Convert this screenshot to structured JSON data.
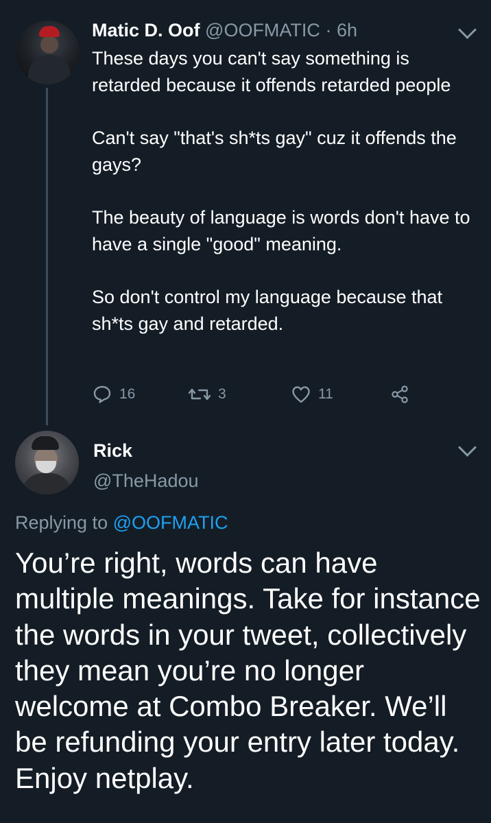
{
  "parent_tweet": {
    "author_name": "Matic D. Oof",
    "handle": "@OOFMATIC",
    "separator": "·",
    "time": "6h",
    "paragraphs": [
      "These days you can't say something is retarded because it offends retarded people",
      "Can't say \"that's sh*ts gay\" cuz it offends the gays?",
      "The beauty of language is words don't have to have a single \"good\" meaning.",
      "So don't control my language because that sh*ts gay and retarded."
    ],
    "actions": {
      "reply_count": "16",
      "retweet_count": "3",
      "like_count": "11"
    }
  },
  "reply_tweet": {
    "author_name": "Rick",
    "handle": "@TheHadou",
    "replying_prefix": "Replying to",
    "replying_handle": "@OOFMATIC",
    "text": "You’re right, words can have multiple meanings. Take for instance the words in your tweet, collectively they mean you’re no longer welcome at Combo Breaker. We’ll be refunding your entry later today. Enjoy netplay."
  },
  "colors": {
    "background": "#141d26",
    "text_primary": "#ffffff",
    "text_secondary": "#8899a6",
    "link": "#1da1f2",
    "thread_line": "#3d4b5b"
  },
  "icons": [
    "reply-icon",
    "retweet-icon",
    "like-icon",
    "share-icon",
    "chevron-down-icon"
  ]
}
